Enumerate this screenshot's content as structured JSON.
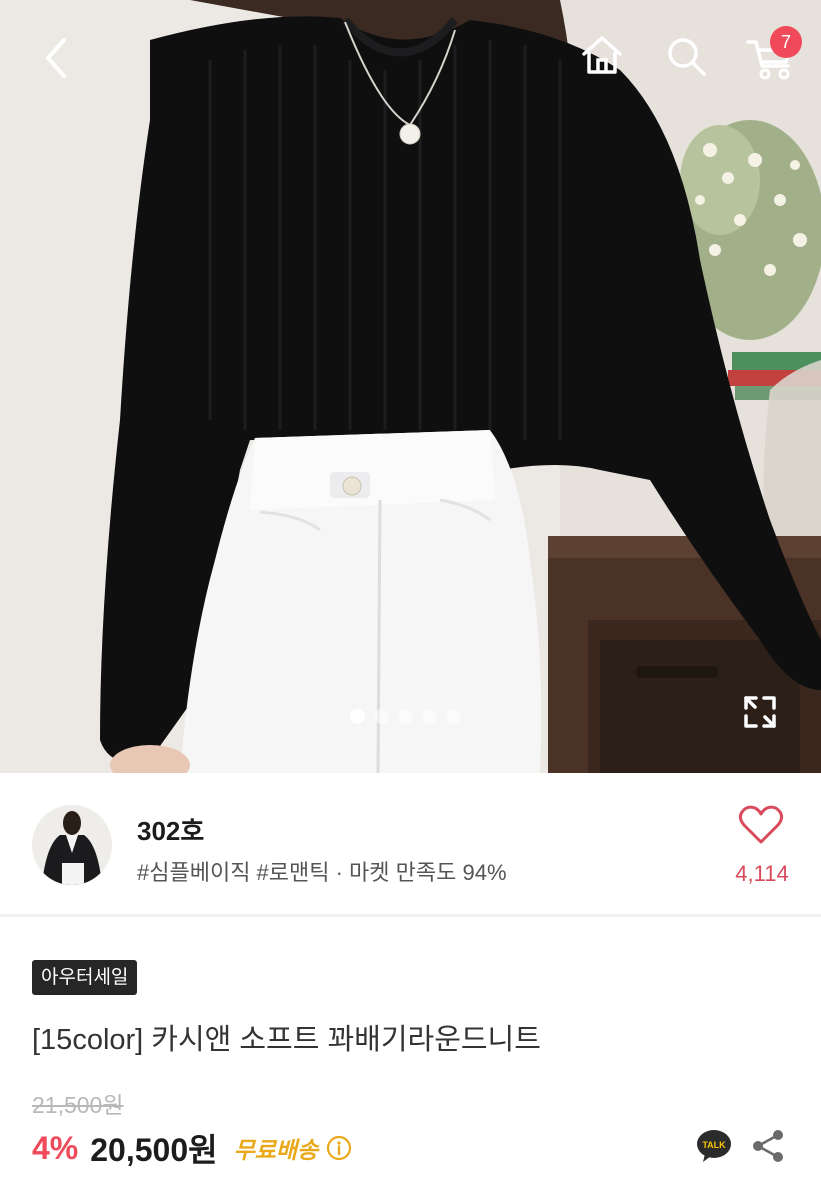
{
  "header": {
    "cart_count": "7"
  },
  "gallery": {
    "image_count": 5,
    "active_index": 0
  },
  "shop": {
    "name": "302호",
    "meta": "#심플베이직 #로맨틱 · 마켓 만족도 94%",
    "like_count": "4,114"
  },
  "product": {
    "badge": "아우터세일",
    "title": "[15color] 카시앤 소프트 꽈배기라운드니트",
    "original_price": "21,500원",
    "discount": "4%",
    "price": "20,500원",
    "shipping": "무료배송",
    "talk_label": "TALK"
  },
  "colors": {
    "accent": "#f04a5a",
    "like": "#d94a5c",
    "shipping": "#e9a91a",
    "badge_bg": "#262626",
    "talk_bg": "#2b2b2b"
  },
  "icons": [
    "chevron-left-icon",
    "home-icon",
    "search-icon",
    "cart-icon",
    "expand-icon",
    "heart-icon",
    "info-icon",
    "talk-icon",
    "share-icon"
  ]
}
